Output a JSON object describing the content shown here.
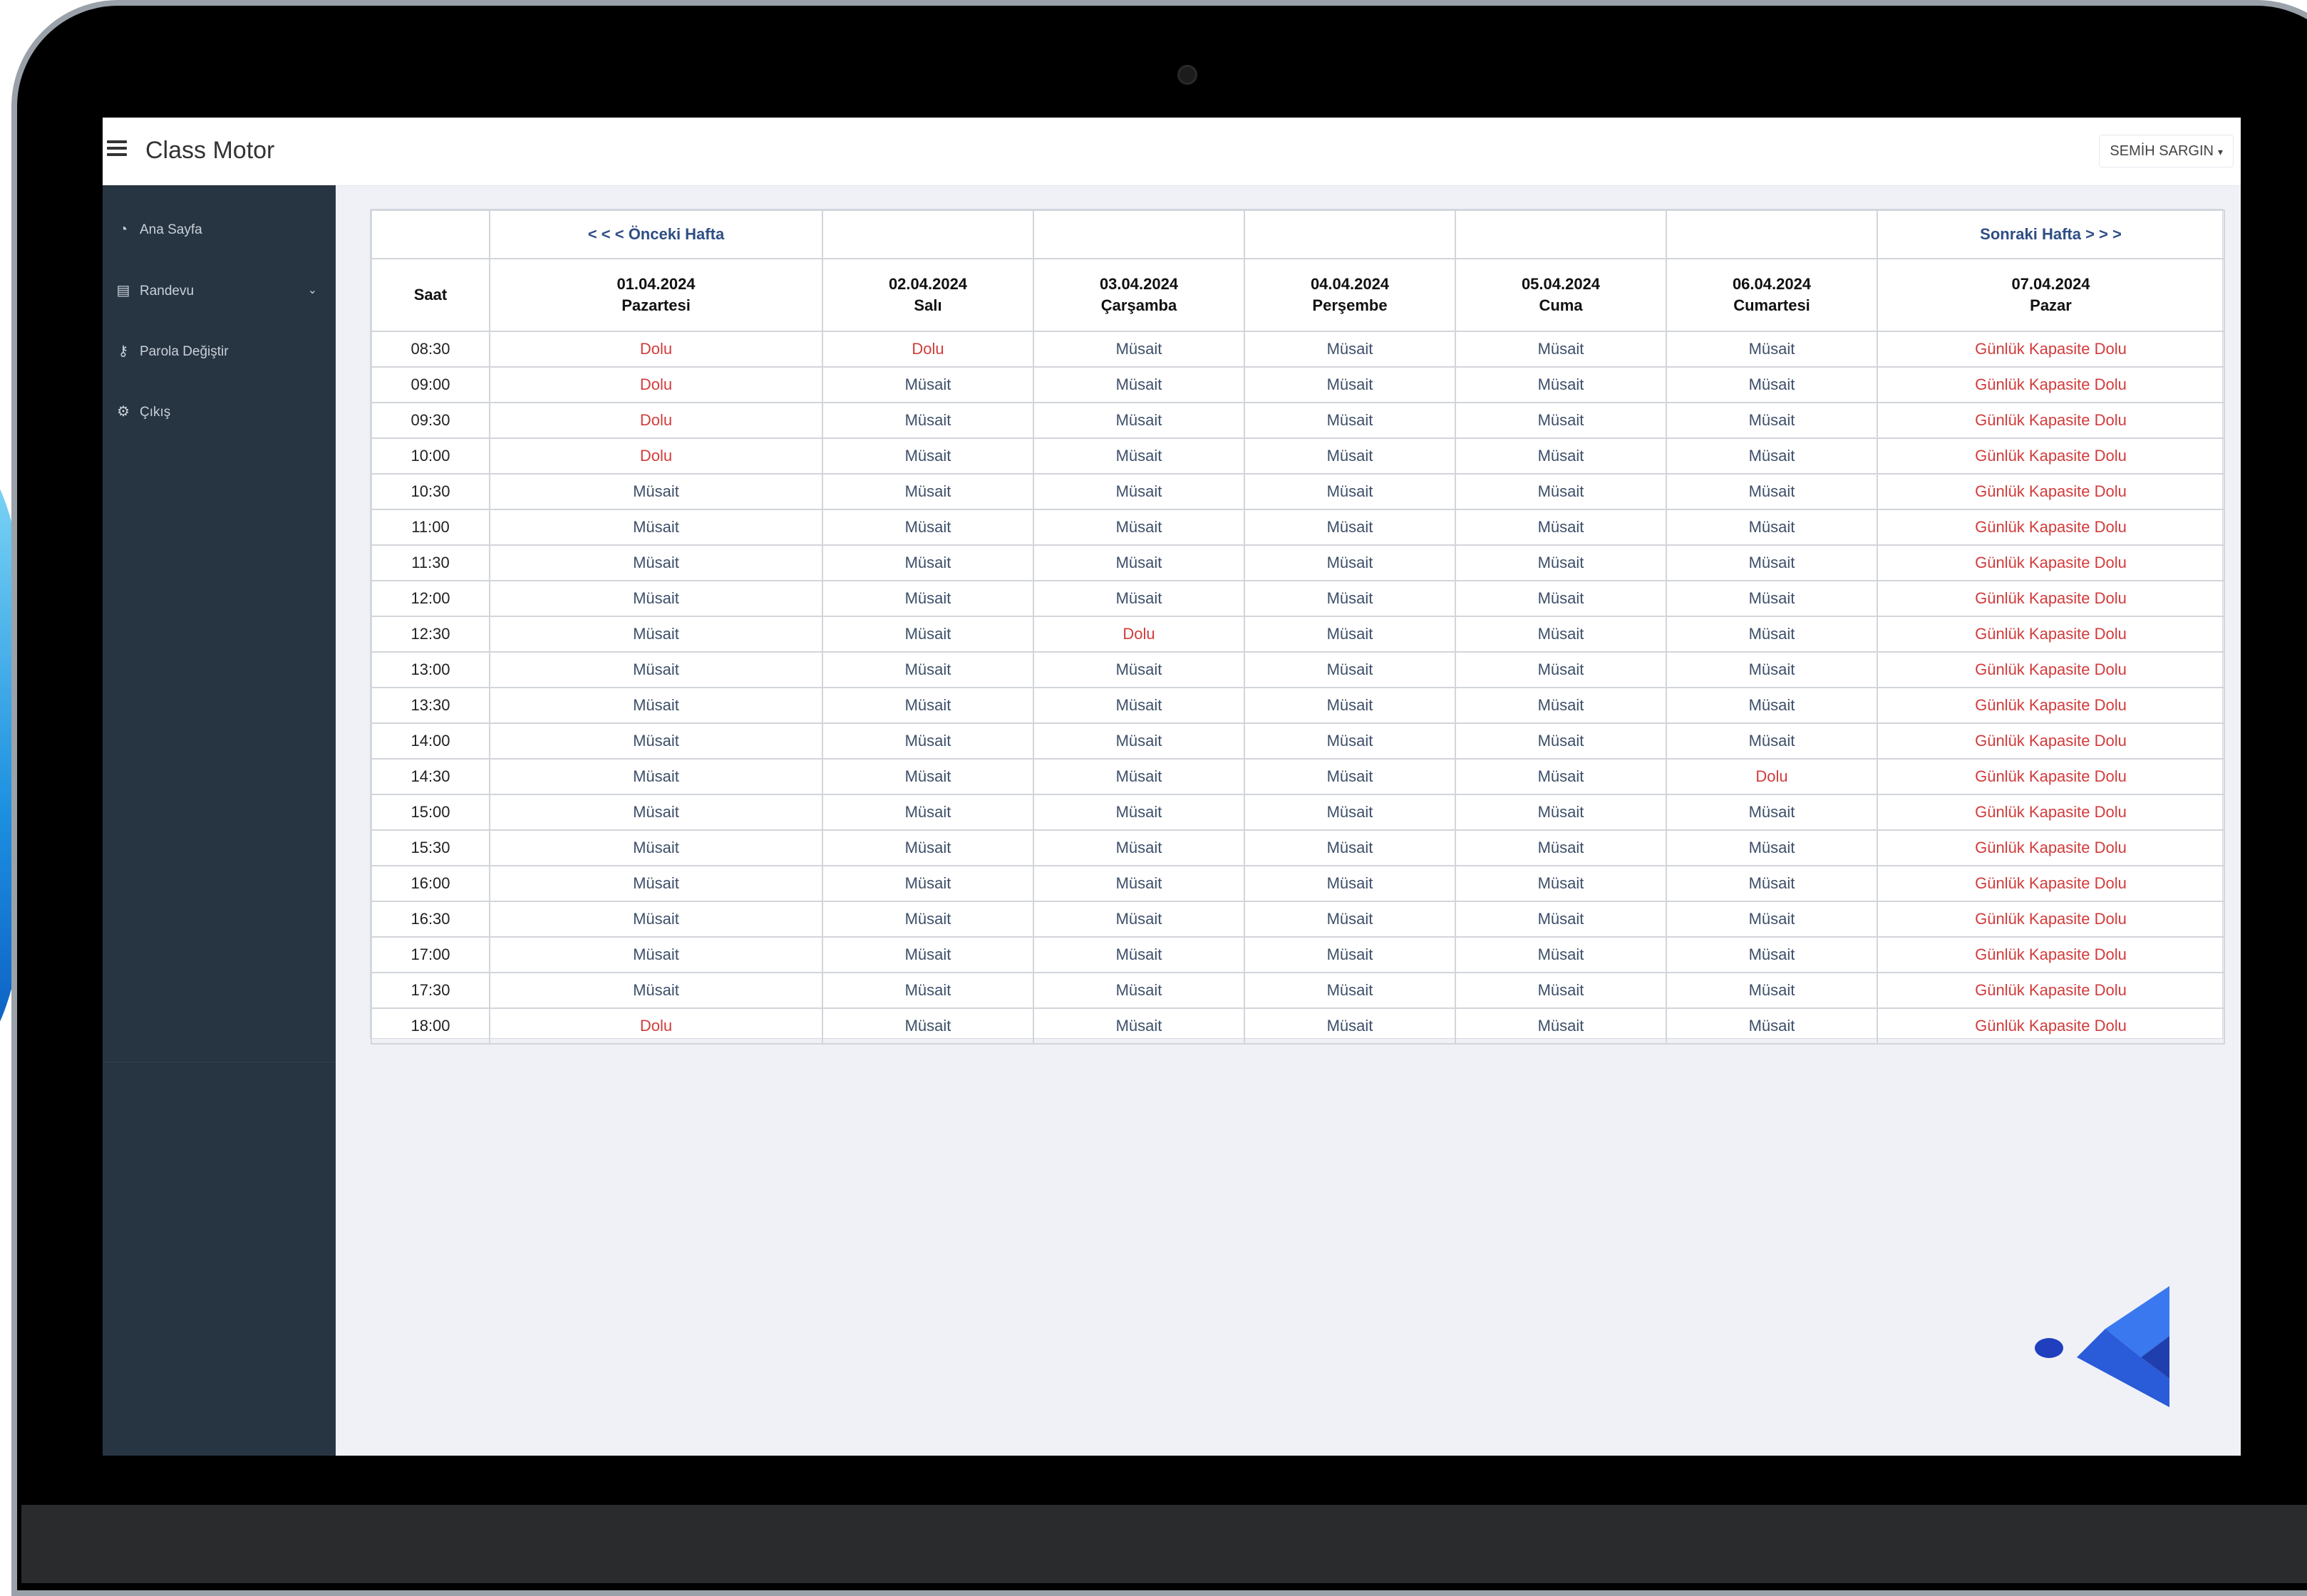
{
  "app": {
    "title": "Class Motor",
    "user": "SEMİH SARGIN"
  },
  "sidebar": {
    "items": [
      {
        "label": "Ana Sayfa",
        "icon": "dashboard-icon"
      },
      {
        "label": "Randevu",
        "icon": "chart-icon",
        "has_submenu": true
      },
      {
        "label": "Parola Değiştir",
        "icon": "key-icon"
      },
      {
        "label": "Çıkış",
        "icon": "gear-icon"
      }
    ]
  },
  "schedule": {
    "prev_week": "< < < Önceki Hafta",
    "next_week": "Sonraki Hafta > > >",
    "time_header": "Saat",
    "days": [
      {
        "date": "01.04.2024",
        "name": "Pazartesi"
      },
      {
        "date": "02.04.2024",
        "name": "Salı"
      },
      {
        "date": "03.04.2024",
        "name": "Çarşamba"
      },
      {
        "date": "04.04.2024",
        "name": "Perşembe"
      },
      {
        "date": "05.04.2024",
        "name": "Cuma"
      },
      {
        "date": "06.04.2024",
        "name": "Cumartesi"
      },
      {
        "date": "07.04.2024",
        "name": "Pazar"
      }
    ],
    "rows": [
      {
        "time": "08:30",
        "cells": [
          "Dolu",
          "Dolu",
          "Müsait",
          "Müsait",
          "Müsait",
          "Müsait",
          "Günlük Kapasite Dolu"
        ]
      },
      {
        "time": "09:00",
        "cells": [
          "Dolu",
          "Müsait",
          "Müsait",
          "Müsait",
          "Müsait",
          "Müsait",
          "Günlük Kapasite Dolu"
        ]
      },
      {
        "time": "09:30",
        "cells": [
          "Dolu",
          "Müsait",
          "Müsait",
          "Müsait",
          "Müsait",
          "Müsait",
          "Günlük Kapasite Dolu"
        ]
      },
      {
        "time": "10:00",
        "cells": [
          "Dolu",
          "Müsait",
          "Müsait",
          "Müsait",
          "Müsait",
          "Müsait",
          "Günlük Kapasite Dolu"
        ]
      },
      {
        "time": "10:30",
        "cells": [
          "Müsait",
          "Müsait",
          "Müsait",
          "Müsait",
          "Müsait",
          "Müsait",
          "Günlük Kapasite Dolu"
        ]
      },
      {
        "time": "11:00",
        "cells": [
          "Müsait",
          "Müsait",
          "Müsait",
          "Müsait",
          "Müsait",
          "Müsait",
          "Günlük Kapasite Dolu"
        ]
      },
      {
        "time": "11:30",
        "cells": [
          "Müsait",
          "Müsait",
          "Müsait",
          "Müsait",
          "Müsait",
          "Müsait",
          "Günlük Kapasite Dolu"
        ]
      },
      {
        "time": "12:00",
        "cells": [
          "Müsait",
          "Müsait",
          "Müsait",
          "Müsait",
          "Müsait",
          "Müsait",
          "Günlük Kapasite Dolu"
        ]
      },
      {
        "time": "12:30",
        "cells": [
          "Müsait",
          "Müsait",
          "Dolu",
          "Müsait",
          "Müsait",
          "Müsait",
          "Günlük Kapasite Dolu"
        ]
      },
      {
        "time": "13:00",
        "cells": [
          "Müsait",
          "Müsait",
          "Müsait",
          "Müsait",
          "Müsait",
          "Müsait",
          "Günlük Kapasite Dolu"
        ]
      },
      {
        "time": "13:30",
        "cells": [
          "Müsait",
          "Müsait",
          "Müsait",
          "Müsait",
          "Müsait",
          "Müsait",
          "Günlük Kapasite Dolu"
        ]
      },
      {
        "time": "14:00",
        "cells": [
          "Müsait",
          "Müsait",
          "Müsait",
          "Müsait",
          "Müsait",
          "Müsait",
          "Günlük Kapasite Dolu"
        ]
      },
      {
        "time": "14:30",
        "cells": [
          "Müsait",
          "Müsait",
          "Müsait",
          "Müsait",
          "Müsait",
          "Dolu",
          "Günlük Kapasite Dolu"
        ]
      },
      {
        "time": "15:00",
        "cells": [
          "Müsait",
          "Müsait",
          "Müsait",
          "Müsait",
          "Müsait",
          "Müsait",
          "Günlük Kapasite Dolu"
        ]
      },
      {
        "time": "15:30",
        "cells": [
          "Müsait",
          "Müsait",
          "Müsait",
          "Müsait",
          "Müsait",
          "Müsait",
          "Günlük Kapasite Dolu"
        ]
      },
      {
        "time": "16:00",
        "cells": [
          "Müsait",
          "Müsait",
          "Müsait",
          "Müsait",
          "Müsait",
          "Müsait",
          "Günlük Kapasite Dolu"
        ]
      },
      {
        "time": "16:30",
        "cells": [
          "Müsait",
          "Müsait",
          "Müsait",
          "Müsait",
          "Müsait",
          "Müsait",
          "Günlük Kapasite Dolu"
        ]
      },
      {
        "time": "17:00",
        "cells": [
          "Müsait",
          "Müsait",
          "Müsait",
          "Müsait",
          "Müsait",
          "Müsait",
          "Günlük Kapasite Dolu"
        ]
      },
      {
        "time": "17:30",
        "cells": [
          "Müsait",
          "Müsait",
          "Müsait",
          "Müsait",
          "Müsait",
          "Müsait",
          "Günlük Kapasite Dolu"
        ]
      },
      {
        "time": "18:00",
        "cells": [
          "Dolu",
          "Müsait",
          "Müsait",
          "Müsait",
          "Müsait",
          "Müsait",
          "Günlük Kapasite Dolu"
        ]
      }
    ]
  },
  "colors": {
    "sidebar": "#273441",
    "available": "#3d4f69",
    "full": "#d23b3b",
    "link": "#2f4e84",
    "accent": "#2d6fe0"
  }
}
